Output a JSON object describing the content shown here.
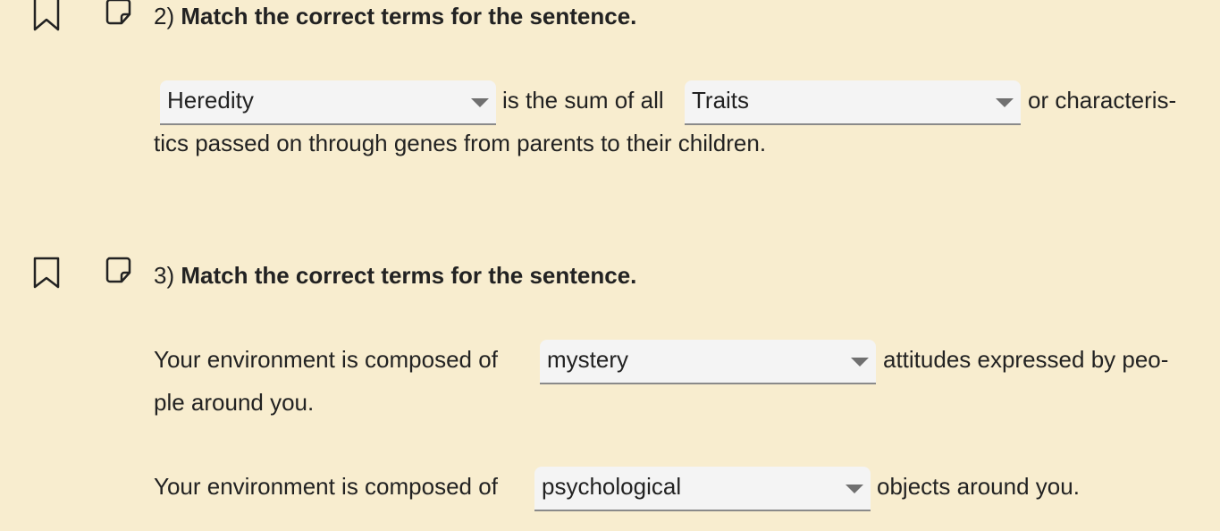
{
  "questions": [
    {
      "number": "2)",
      "title": "Match the correct terms for the sentence.",
      "sentences": [
        {
          "dropdown1": "Heredity",
          "text1": "is the sum of all",
          "dropdown2": "Traits",
          "text2": "or characteris-",
          "text3": "tics passed on through genes from parents to their children."
        }
      ]
    },
    {
      "number": "3)",
      "title": "Match the correct terms for the sentence.",
      "sentences": [
        {
          "prefix": "Your environment is composed of",
          "dropdown": "mystery",
          "suffix": "attitudes expressed by peo-",
          "cont": "ple around you."
        },
        {
          "prefix": "Your environment is composed of",
          "dropdown": "psychological",
          "suffix": "objects around you."
        }
      ]
    }
  ],
  "icons": {
    "bookmark": "bookmark-icon",
    "note": "note-icon"
  }
}
